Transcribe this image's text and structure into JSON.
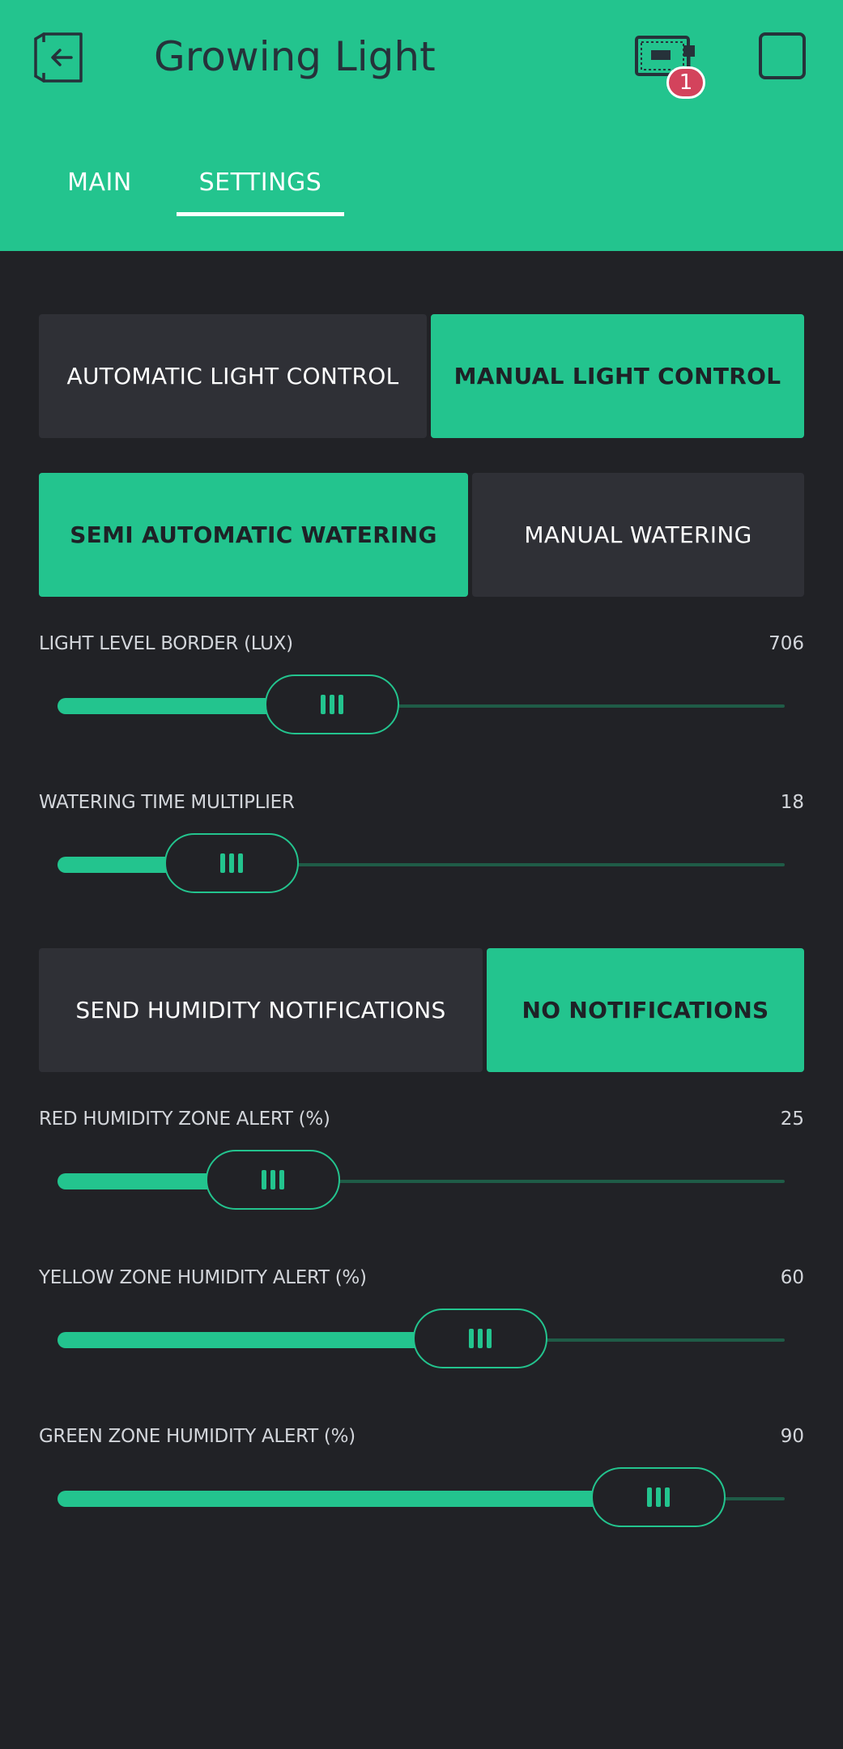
{
  "header": {
    "title": "Growing Light",
    "badge_count": "1",
    "icons": {
      "back": "exit-arrow-icon",
      "device": "device-board-icon",
      "square": "square-icon"
    },
    "accent_color": "#23c48e",
    "text_color": "#26323a"
  },
  "tabs": [
    {
      "label": "MAIN",
      "active": false
    },
    {
      "label": "SETTINGS",
      "active": true
    }
  ],
  "segments": [
    {
      "options": [
        {
          "label": "AUTOMATIC LIGHT CONTROL",
          "selected": false
        },
        {
          "label": "MANUAL LIGHT CONTROL",
          "selected": true
        }
      ]
    },
    {
      "options": [
        {
          "label": "SEMI AUTOMATIC WATERING",
          "selected": true
        },
        {
          "label": "MANUAL WATERING",
          "selected": false
        }
      ]
    },
    {
      "options": [
        {
          "label": "SEND HUMIDITY NOTIFICATIONS",
          "selected": false
        },
        {
          "label": "NO NOTIFICATIONS",
          "selected": true
        }
      ]
    }
  ],
  "sliders": [
    {
      "label": "LIGHT LEVEL BORDER (LUX)",
      "value": "706",
      "fraction": 0.35
    },
    {
      "label": "WATERING TIME MULTIPLIER",
      "value": "18",
      "fraction": 0.18
    },
    {
      "label": "RED HUMIDITY ZONE ALERT (%)",
      "value": "25",
      "fraction": 0.25
    },
    {
      "label": "YELLOW ZONE HUMIDITY ALERT (%)",
      "value": "60",
      "fraction": 0.6
    },
    {
      "label": "GREEN ZONE HUMIDITY ALERT (%)",
      "value": "90",
      "fraction": 0.9
    }
  ],
  "colors": {
    "background": "#212226",
    "segment_off": "#2f3036",
    "segment_on": "#23c48e",
    "track_inactive": "#1f5c47",
    "badge": "#d3435c"
  }
}
